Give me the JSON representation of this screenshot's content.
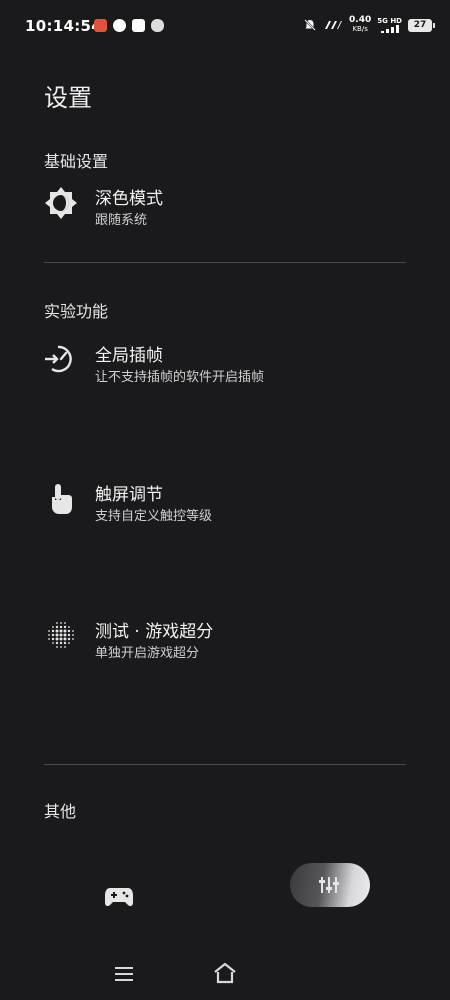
{
  "status_bar": {
    "time": "10:14:54",
    "net_speed_value": "0.40",
    "net_speed_unit": "KB/s",
    "network_label": "5G HD",
    "battery": "27"
  },
  "page": {
    "title": "设置"
  },
  "sections": {
    "basic": {
      "header": "基础设置",
      "dark_mode": {
        "title": "深色模式",
        "subtitle": "跟随系统"
      }
    },
    "experimental": {
      "header": "实验功能",
      "frame_interp": {
        "title": "全局插帧",
        "subtitle": "让不支持插帧的软件开启插帧"
      },
      "touch": {
        "title": "触屏调节",
        "subtitle": "支持自定义触控等级"
      },
      "upscale": {
        "title": "测试 · 游戏超分",
        "subtitle": "单独开启游戏超分"
      }
    },
    "other": {
      "header": "其他"
    }
  },
  "icons": {
    "dark_mode": "brightness-auto-icon",
    "frame_interp": "timer-arrow-icon",
    "touch": "touch-hand-icon",
    "upscale": "dot-grid-icon",
    "nav_game": "gamepad-icon",
    "nav_settings": "settings-icon"
  },
  "colors": {
    "background": "#1a1a1c",
    "divider": "#4a4a4e",
    "text": "#f2f2f2"
  }
}
